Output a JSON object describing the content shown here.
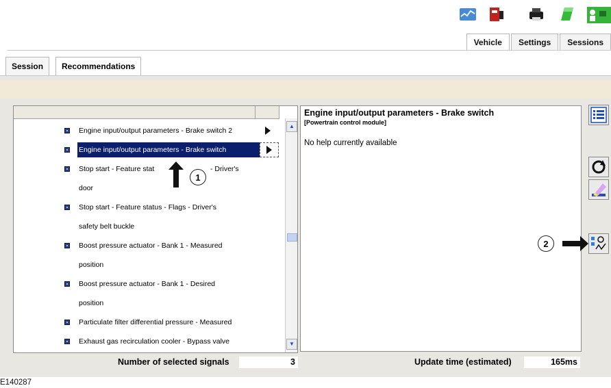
{
  "toolbar_icons": [
    "signal-chart-icon",
    "vehicle-module-icon",
    "printer-icon",
    "network-icon",
    "user-data-icon"
  ],
  "main_tabs": [
    "Vehicle",
    "Settings",
    "Sessions"
  ],
  "sub_tabs": [
    "Session",
    "Recommendations"
  ],
  "signal_list": {
    "rows": [
      {
        "lines": [
          "Engine input/output parameters  -  Brake switch 2"
        ]
      },
      {
        "lines": [
          "Engine input/output parameters  -  Brake switch"
        ],
        "selected": true
      },
      {
        "lines": [
          "Stop start  -  Feature stat",
          "door"
        ],
        "obscured_tail": "-  Driver's"
      },
      {
        "lines": [
          "Stop start  -  Feature status  -  Flags  -  Driver's",
          "safety belt buckle"
        ]
      },
      {
        "lines": [
          "Boost pressure actuator  -  Bank 1  -  Measured",
          "position"
        ]
      },
      {
        "lines": [
          "Boost pressure actuator  -  Bank 1  -  Desired",
          "position"
        ]
      },
      {
        "lines": [
          "Particulate filter differential pressure  -  Measured"
        ]
      },
      {
        "lines": [
          "Exhaust gas recirculation cooler  -  Bypass valve"
        ]
      }
    ]
  },
  "help_panel": {
    "title": "Engine input/output parameters  -  Brake switch",
    "subtitle": "[Powertrain control module]",
    "body": "No help currently available"
  },
  "side_buttons": [
    "list-view-icon",
    "refresh-icon",
    "eraser-icon",
    "signal-monitor-icon"
  ],
  "callouts": [
    "1",
    "2"
  ],
  "status": {
    "selected_label": "Number of selected signals",
    "selected_value": "3",
    "update_label": "Update time (estimated)",
    "update_value": "165ms"
  },
  "figure_code": "E140287",
  "colors": {
    "selection": "#0c1f6c",
    "band": "#f1ead6",
    "background": "#e9e7e2"
  }
}
